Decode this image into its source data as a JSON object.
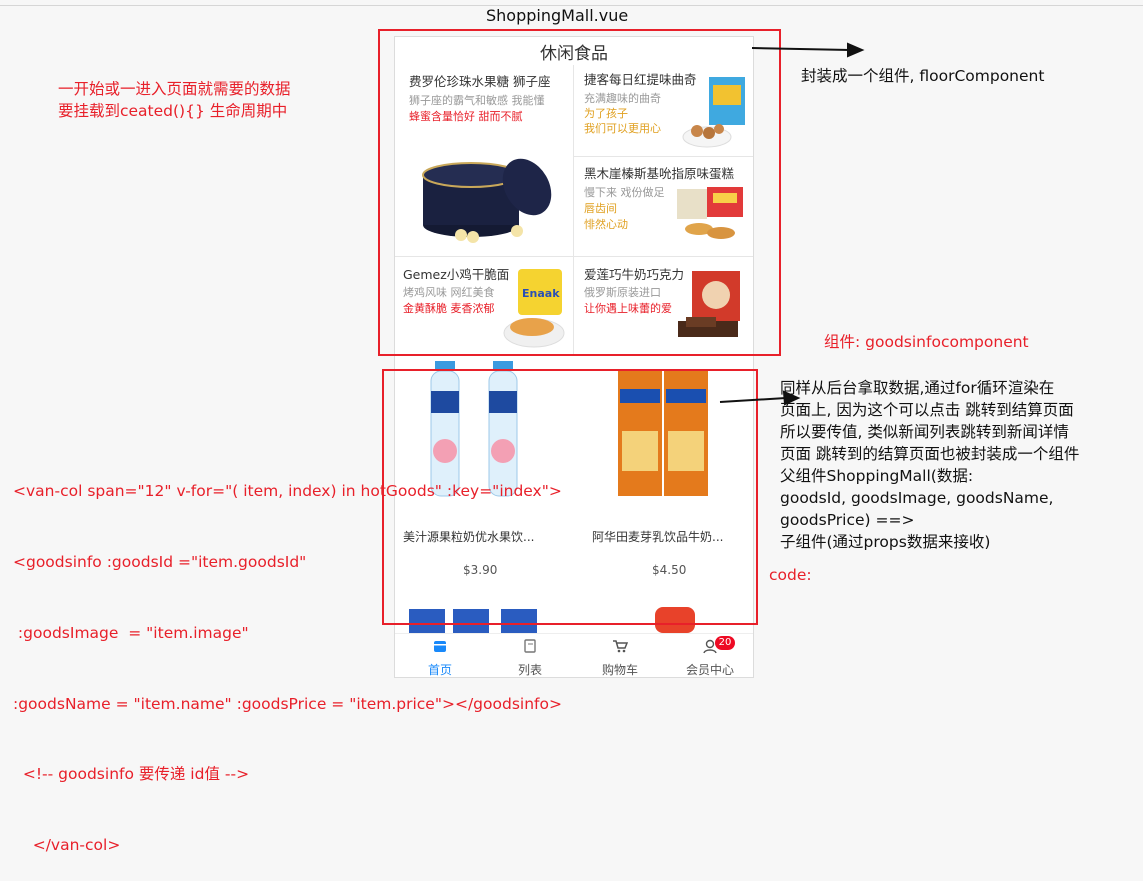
{
  "file_title": "ShoppingMall.vue",
  "floor": {
    "title": "休闲食品",
    "items": [
      {
        "name": "费罗伦珍珠水果糖 狮子座",
        "sub1": "狮子座的霸气和敏感  我能懂",
        "sub2": "蜂蜜含量恰好  甜而不腻"
      },
      {
        "name": "捷客每日红提味曲奇",
        "sub1": "充满趣味的曲奇",
        "sub2": "为了孩子",
        "sub3": "我们可以更用心"
      },
      {
        "name": "黑木崖榛斯基吮指原味蛋糕",
        "sub1": "慢下来  戏份做足",
        "sub2": "唇齿间",
        "sub3": "悱然心动"
      },
      {
        "name": "Gemez小鸡干脆面",
        "sub1": "烤鸡风味  网红美食",
        "sub2": "金黄酥脆  麦香浓郁"
      },
      {
        "name": "爱莲巧牛奶巧克力",
        "sub1": "俄罗斯原装进口",
        "sub2": "让你遇上味蕾的爱"
      }
    ]
  },
  "goods": [
    {
      "name": "美汁源果粒奶优水果饮...",
      "price": "$3.90"
    },
    {
      "name": "阿华田麦芽乳饮品牛奶...",
      "price": "$4.50"
    }
  ],
  "tabbar": [
    {
      "label": "首页",
      "active": true
    },
    {
      "label": "列表",
      "active": false
    },
    {
      "label": "购物车",
      "active": false
    },
    {
      "label": "会员中心",
      "active": false,
      "badge": "20"
    }
  ],
  "annotations": {
    "left_note": [
      "一开始或一进入页面就需要的数据",
      "要挂载到ceated(){} 生命周期中"
    ],
    "floor_component": "封装成一个组件, floorComponent",
    "goods_component": "组件: goodsinfocomponent",
    "right_note": [
      " 同样从后台拿取数据,通过for循环渲染在",
      "页面上, 因为这个可以点击 跳转到结算页面",
      "所以要传值,  类似新闻列表跳转到新闻详情",
      "页面 跳转到的结算页面也被封装成一个组件",
      "父组件ShoppingMall(数据:",
      "goodsId, goodsImage, goodsName,",
      "goodsPrice) ==>",
      "  子组件(通过props数据来接收)"
    ],
    "code_label": "code:",
    "code_lines": [
      "<van-col span=\"12\" v-for=\"( item, index) in hotGoods\" :key=\"index\">",
      "<goodsinfo :goodsId =\"item.goodsId\"",
      " :goodsImage  = \"item.image\"",
      ":goodsName = \"item.name\" :goodsPrice = \"item.price\"></goodsinfo>",
      "  <!-- goodsinfo 要传递 id值 -->",
      "    </van-col>"
    ]
  },
  "colors": {
    "annotation_red": "#e8202a",
    "tab_active": "#1989fa",
    "badge": "#ee0a24"
  }
}
